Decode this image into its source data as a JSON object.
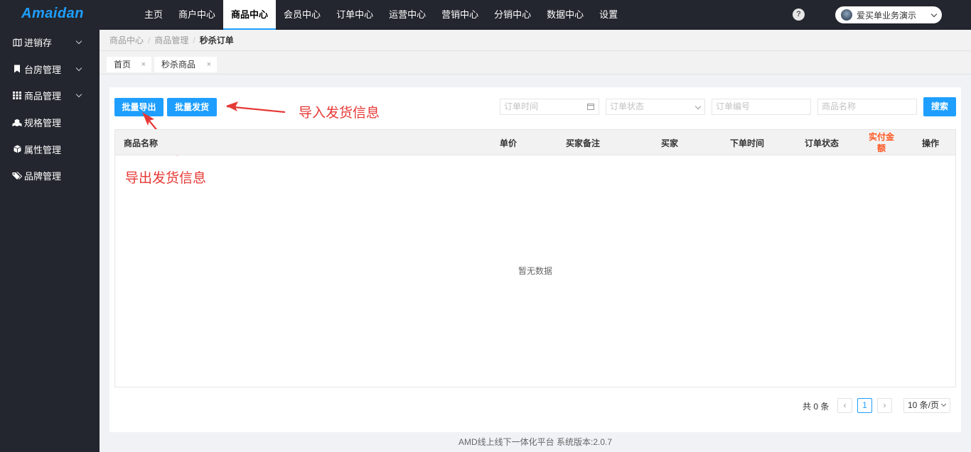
{
  "app": {
    "logo": "Amaidan"
  },
  "topnav": {
    "items": [
      "主页",
      "商户中心",
      "商品中心",
      "会员中心",
      "订单中心",
      "运营中心",
      "营销中心",
      "分销中心",
      "数据中心",
      "设置"
    ],
    "active_index": 2,
    "help_label": "?",
    "user_name": "爱买单业务演示"
  },
  "sidebar": {
    "items": [
      {
        "label": "进销存",
        "icon": "map-icon",
        "expandable": true
      },
      {
        "label": "台房管理",
        "icon": "bookmark-icon",
        "expandable": true
      },
      {
        "label": "商品管理",
        "icon": "grid-icon",
        "expandable": true
      },
      {
        "label": "规格管理",
        "icon": "cubes-icon",
        "expandable": false
      },
      {
        "label": "属性管理",
        "icon": "cube-icon",
        "expandable": false
      },
      {
        "label": "品牌管理",
        "icon": "tags-icon",
        "expandable": false
      }
    ]
  },
  "breadcrumb": {
    "items": [
      "商品中心",
      "商品管理"
    ],
    "current": "秒杀订单",
    "separator": "/"
  },
  "tabs": {
    "items": [
      "首页",
      "秒杀商品"
    ],
    "close": "×"
  },
  "toolbar": {
    "export_label": "批量导出",
    "ship_label": "批量发货",
    "annotation_import": "导入发货信息",
    "annotation_export": "导出发货信息"
  },
  "filters": {
    "order_time_placeholder": "订单时间",
    "order_status_placeholder": "订单状态",
    "order_no_placeholder": "订单编号",
    "product_name_placeholder": "商品名称",
    "search_label": "搜索"
  },
  "table": {
    "columns": {
      "product_name": "商品名称",
      "unit_price": "单价",
      "buyer_note": "买家备注",
      "buyer": "买家",
      "order_time": "下单时间",
      "order_status": "订单状态",
      "paid_amount_line1": "实付金",
      "paid_amount_line2": "额",
      "actions": "操作"
    },
    "empty_text": "暂无数据"
  },
  "pagination": {
    "total_text": "共 0 条",
    "prev": "‹",
    "current_page": "1",
    "next": "›",
    "page_size": "10 条/页"
  },
  "footer": {
    "text": "AMD线上线下一体化平台 系统版本:2.0.7"
  },
  "colors": {
    "primary": "#1e9fff",
    "sidebar_bg": "#23262e",
    "annotation": "#e53935",
    "paid_amount": "#ff5722"
  }
}
